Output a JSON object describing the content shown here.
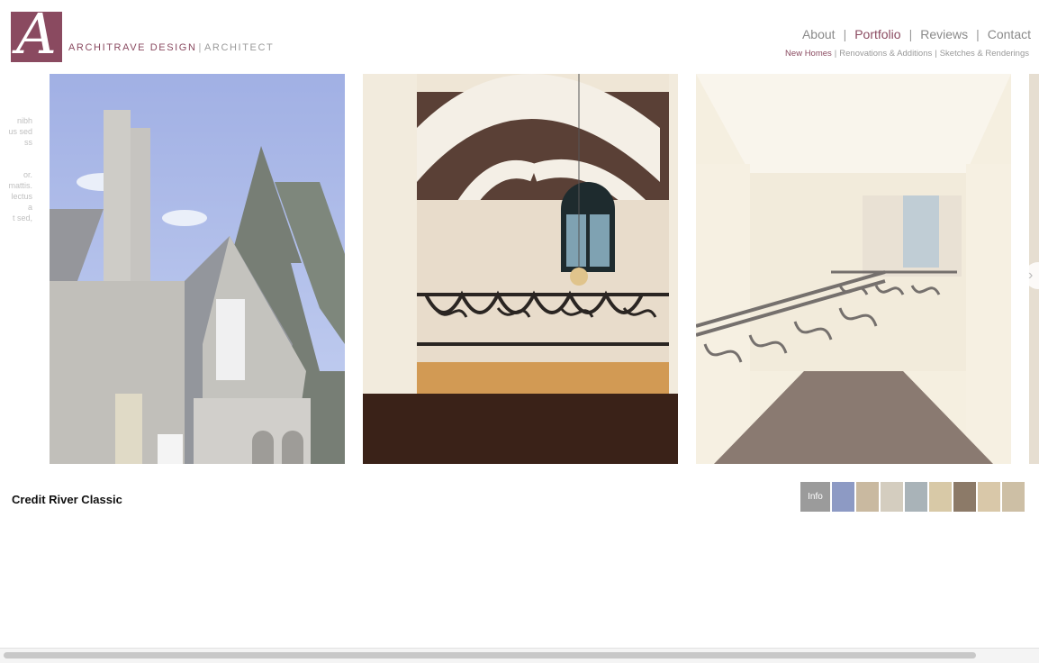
{
  "brand": {
    "logo_letter": "A",
    "name": "ARCHITRAVE DESIGN",
    "separator": "|",
    "sub": "ARCHITECT",
    "accent_color": "#8a4a60"
  },
  "nav": {
    "items": [
      {
        "label": "About",
        "active": false
      },
      {
        "label": "Portfolio",
        "active": true
      },
      {
        "label": "Reviews",
        "active": false
      },
      {
        "label": "Contact",
        "active": false
      }
    ],
    "separator": "|"
  },
  "subnav": {
    "items": [
      {
        "label": "New Homes",
        "active": true
      },
      {
        "label": "Renovations & Additions",
        "active": false
      },
      {
        "label": "Sketches & Renderings",
        "active": false
      }
    ],
    "separator": "|"
  },
  "side_text": [
    "nibh",
    "us sed",
    "ss",
    "",
    "",
    "or.",
    "mattis.",
    "lectus",
    "a",
    "t sed,"
  ],
  "gallery": {
    "slides": [
      {
        "name": "stone-house-exterior"
      },
      {
        "name": "staircase-landing-window"
      },
      {
        "name": "upper-hallway-railing"
      },
      {
        "name": "partial-next-slide"
      }
    ],
    "next_icon": "chevron-right-icon"
  },
  "project": {
    "caption": "Credit River Classic"
  },
  "thumbnails": {
    "info_label": "Info",
    "items": [
      {
        "color": "#8d9ac4"
      },
      {
        "color": "#c9b9a0"
      },
      {
        "color": "#d4cdbf"
      },
      {
        "color": "#a9b3b8"
      },
      {
        "color": "#d8c9a7"
      },
      {
        "color": "#8c7a68"
      },
      {
        "color": "#d9c8a9"
      },
      {
        "color": "#cdbfa5"
      }
    ]
  }
}
